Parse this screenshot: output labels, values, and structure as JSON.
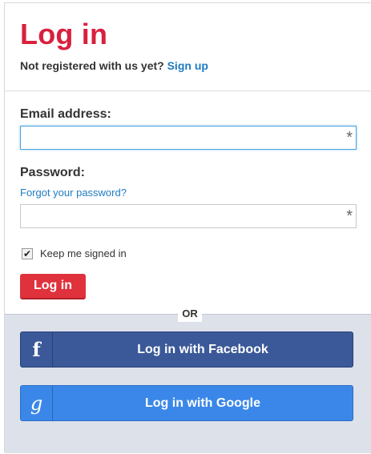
{
  "heading": {
    "title": "Log in",
    "not_registered": "Not registered with us yet?",
    "signup_link": "Sign up"
  },
  "form": {
    "email_label": "Email address:",
    "password_label": "Password:",
    "forgot_link": "Forgot your password?",
    "email_value": "",
    "password_value": "",
    "required_marker": "*",
    "keep_signed_in_label": "Keep me signed in",
    "keep_signed_in_checked": "✔",
    "login_button": "Log in"
  },
  "divider": {
    "or": "OR"
  },
  "social": {
    "facebook_icon": "f",
    "facebook_label": "Log in with Facebook",
    "google_icon": "g",
    "google_label": "Log in with Google"
  },
  "colors": {
    "title": "#d8213f",
    "link": "#1f7bc1",
    "login_button": "#e0323c",
    "facebook": "#3b5998",
    "google": "#3b87e9"
  }
}
